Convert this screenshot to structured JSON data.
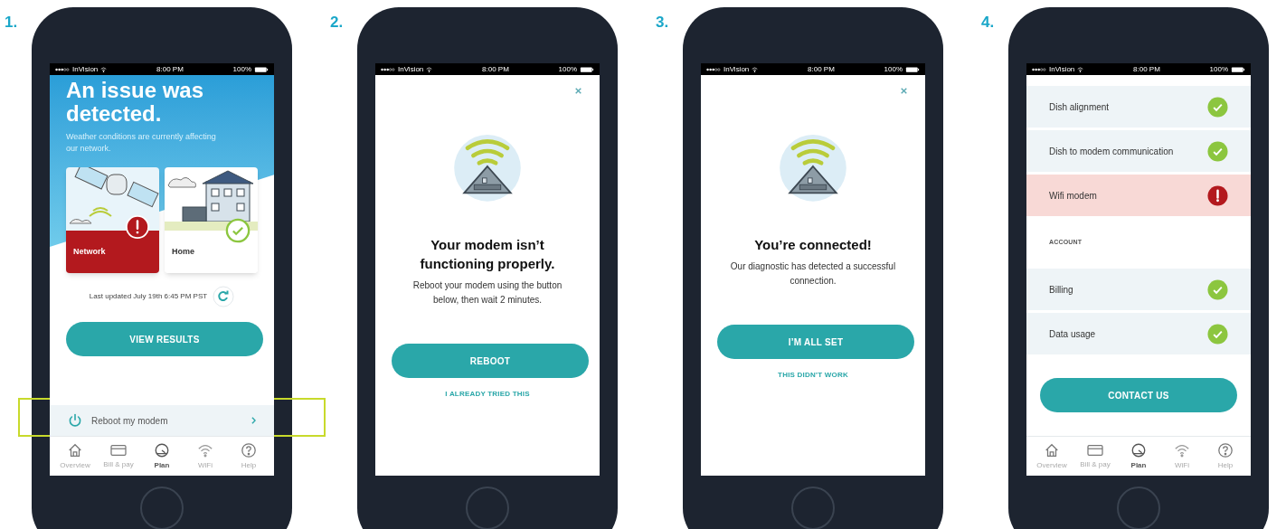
{
  "phones": [
    {
      "number": "1.",
      "status_bar": {
        "carrier": "InVision",
        "time": "8:00 PM",
        "battery": "100%"
      },
      "screen": {
        "kind": "issue",
        "title": "An issue was detected.",
        "subtitle": "Weather conditions are currently affecting our network.",
        "cards": [
          {
            "label": "Network",
            "alert": true
          },
          {
            "label": "Home",
            "alert": false
          }
        ],
        "updated": "Last updated July 19th 6:45 PM PST",
        "button": "VIEW RESULTS",
        "row": {
          "label": "Reboot my modem",
          "highlighted": true
        },
        "tabs": [
          {
            "label": "Overview",
            "selected": false
          },
          {
            "label": "Bill & pay",
            "selected": false
          },
          {
            "label": "Plan",
            "selected": true
          },
          {
            "label": "WiFi",
            "selected": false
          },
          {
            "label": "Help",
            "selected": false
          }
        ]
      }
    },
    {
      "number": "2.",
      "status_bar": {
        "carrier": "InVision",
        "time": "8:00 PM",
        "battery": "100%"
      },
      "screen": {
        "kind": "modal",
        "title": "Your modem isn’t functioning properly.",
        "message": "Reboot your modem using the button below, then wait 2 minutes.",
        "primary": "REBOOT",
        "secondary": "I ALREADY TRIED THIS"
      }
    },
    {
      "number": "3.",
      "status_bar": {
        "carrier": "InVision",
        "time": "8:00 PM",
        "battery": "100%"
      },
      "screen": {
        "kind": "modal",
        "title": "You’re connected!",
        "message": "Our diagnostic has detected a successful connection.",
        "primary": "I’M ALL SET",
        "secondary": "THIS DIDN’T WORK"
      }
    },
    {
      "number": "4.",
      "status_bar": {
        "carrier": "InVision",
        "time": "8:00 PM",
        "battery": "100%"
      },
      "screen": {
        "kind": "results",
        "items": [
          {
            "kind": "check",
            "label": "Dish alignment",
            "alert": false
          },
          {
            "kind": "check",
            "label": "Dish to modem communication",
            "alert": false
          },
          {
            "kind": "check",
            "label": "Wifi modem",
            "alert": true
          },
          {
            "kind": "heading",
            "label": "ACCOUNT"
          },
          {
            "kind": "check",
            "label": "Billing",
            "alert": false
          },
          {
            "kind": "check",
            "label": "Data usage",
            "alert": false
          }
        ],
        "button": "CONTACT US",
        "tabs": [
          {
            "label": "Overview",
            "selected": false
          },
          {
            "label": "Bill & pay",
            "selected": false
          },
          {
            "label": "Plan",
            "selected": true
          },
          {
            "label": "WiFi",
            "selected": false
          },
          {
            "label": "Help",
            "selected": false
          }
        ]
      }
    }
  ]
}
